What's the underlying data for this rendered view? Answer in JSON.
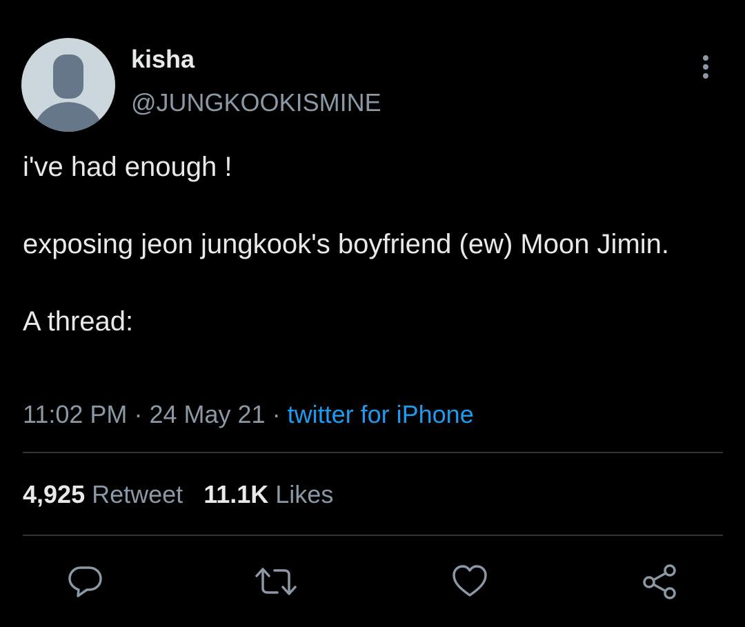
{
  "user": {
    "display_name": "kisha",
    "handle": "@JUNGKOOKISMINE",
    "avatar_icon": "default-profile-icon"
  },
  "tweet": {
    "text": "i've had enough !\n\nexposing jeon jungkook's boyfriend (ew) Moon Jimin.\n\nA thread:",
    "time": "11:02 PM",
    "date": "24 May 21",
    "separator": "·",
    "source": "twitter for iPhone"
  },
  "stats": {
    "retweets_count": "4,925",
    "retweets_label": "Retweet",
    "likes_count": "11.1K",
    "likes_label": "Likes"
  },
  "actions": [
    "reply-icon",
    "retweet-icon",
    "like-icon",
    "share-icon"
  ],
  "colors": {
    "background": "#000000",
    "primary_text": "#e7e9ea",
    "secondary_text": "#8b98a5",
    "link": "#1d9bf0",
    "divider": "#2f3336",
    "avatar_bg": "#ccd6dd",
    "avatar_fg": "#66778a"
  }
}
